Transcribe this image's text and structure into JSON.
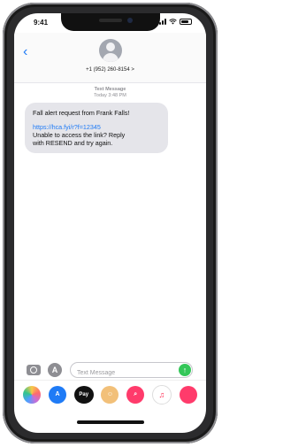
{
  "status_bar": {
    "time": "9:41"
  },
  "header": {
    "back_icon": "chevron-left-icon",
    "contact": "+1 (952) 260-8154 >"
  },
  "thread_meta": {
    "label": "Text Message",
    "timestamp": "Today 3:48 PM"
  },
  "message": {
    "line1": "Fall alert request from Frank Falls!",
    "link": "https://hca.fyi/r?f=12345",
    "line2": "Unable to access the link? Reply",
    "line3": "with RESEND and try again."
  },
  "composer": {
    "placeholder": "Text Message",
    "send_icon": "arrow-up-icon"
  },
  "app_drawer": {
    "apple_pay_label": "Pay",
    "icons": [
      "photos-icon",
      "app-store-icon",
      "apple-pay-icon",
      "animoji-icon",
      "image-search-icon",
      "music-icon",
      "more-icon"
    ]
  },
  "colors": {
    "accent": "#1f7bf6",
    "bubble": "#e5e5ea",
    "send": "#34c759"
  }
}
